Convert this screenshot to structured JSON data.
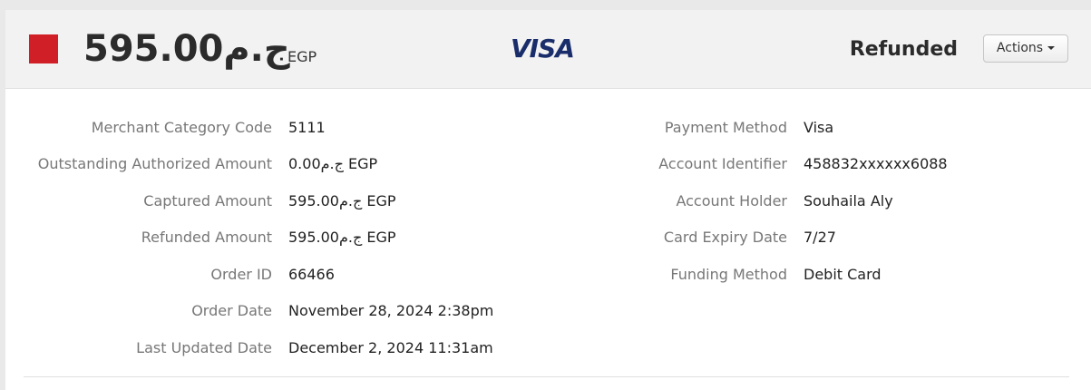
{
  "header": {
    "status_color": "#d11f27",
    "amount": "595.00ج.م",
    "currency": "EGP",
    "card_brand": "VISA",
    "status": "Refunded",
    "actions_label": "Actions"
  },
  "left_fields": [
    {
      "label": "Merchant Category Code",
      "value": "5111"
    },
    {
      "label": "Outstanding Authorized Amount",
      "value": "0.00ج.م EGP"
    },
    {
      "label": "Captured Amount",
      "value": "595.00ج.م EGP"
    },
    {
      "label": "Refunded Amount",
      "value": "595.00ج.م EGP"
    },
    {
      "label": "Order ID",
      "value": "66466"
    },
    {
      "label": "Order Date",
      "value": "November 28, 2024 2:38pm"
    },
    {
      "label": "Last Updated Date",
      "value": "December 2, 2024 11:31am"
    }
  ],
  "right_fields": [
    {
      "label": "Payment Method",
      "value": "Visa"
    },
    {
      "label": "Account Identifier",
      "value": "458832xxxxxx6088"
    },
    {
      "label": "Account Holder",
      "value": "Souhaila Aly"
    },
    {
      "label": "Card Expiry Date",
      "value": "7/27"
    },
    {
      "label": "Funding Method",
      "value": "Debit Card"
    }
  ]
}
